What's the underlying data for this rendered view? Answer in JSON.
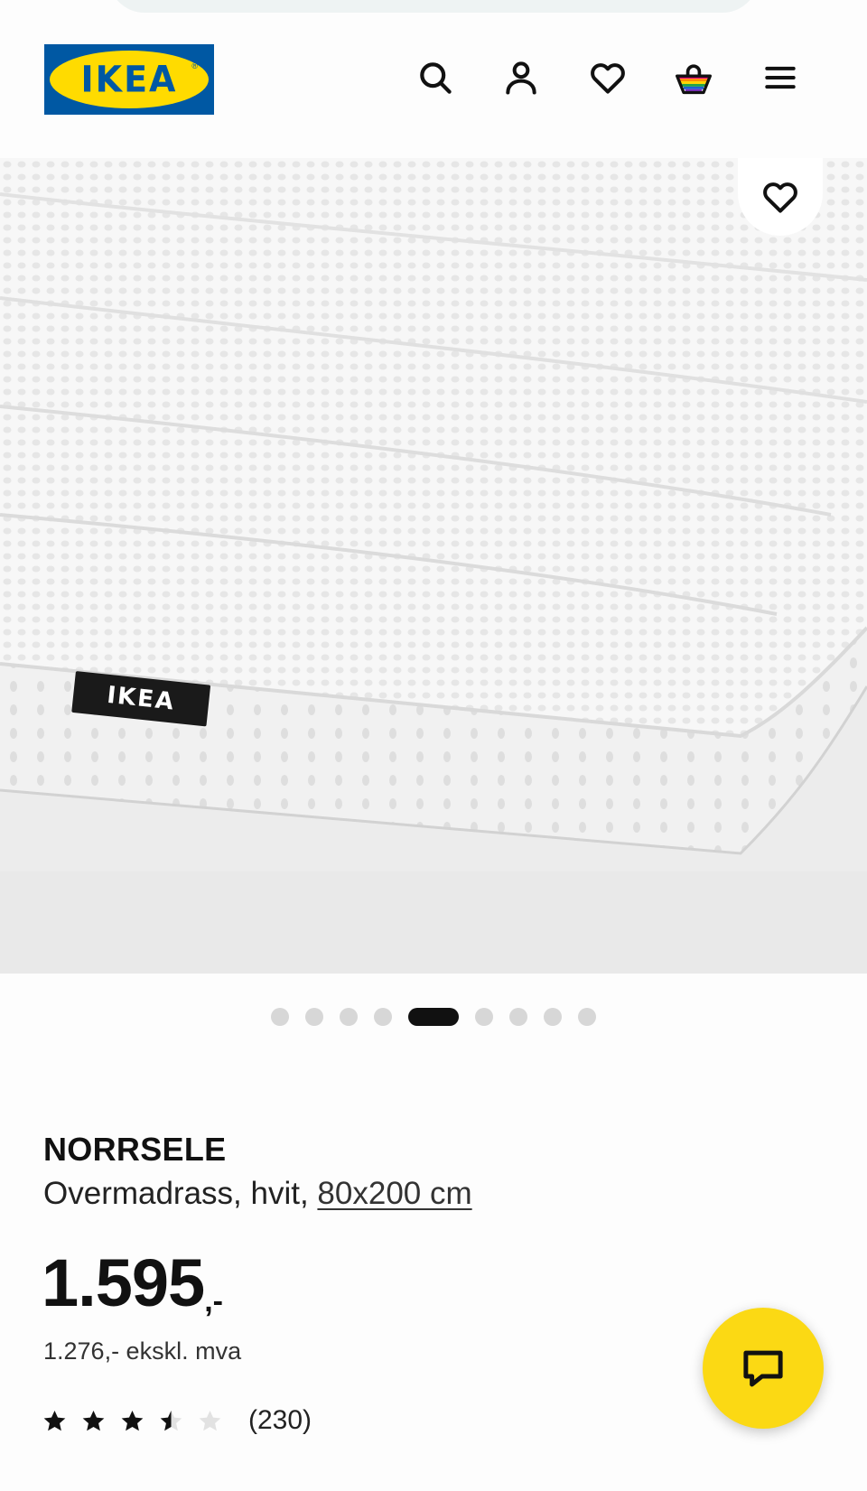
{
  "header": {
    "logo_text": "IKEA",
    "logo_reg": "®",
    "icons": [
      "search-icon",
      "user-icon",
      "heart-icon",
      "basket-icon",
      "menu-icon"
    ]
  },
  "gallery": {
    "image_logo_text": "IKEA",
    "dots_total": 9,
    "active_dot": 5
  },
  "product": {
    "name": "NORRSELE",
    "description": "Overmadrass, hvit, ",
    "size": "80x200 cm",
    "price": "1.595",
    "price_suffix": ",-",
    "price_ex_vat": "1.276,- ekskl. mva",
    "rating": 3.5,
    "rating_max": 5,
    "review_count": "(230)"
  },
  "colors": {
    "ikea_blue": "#0058a3",
    "ikea_yellow": "#ffdb00",
    "chat_yellow": "#fbd914"
  }
}
